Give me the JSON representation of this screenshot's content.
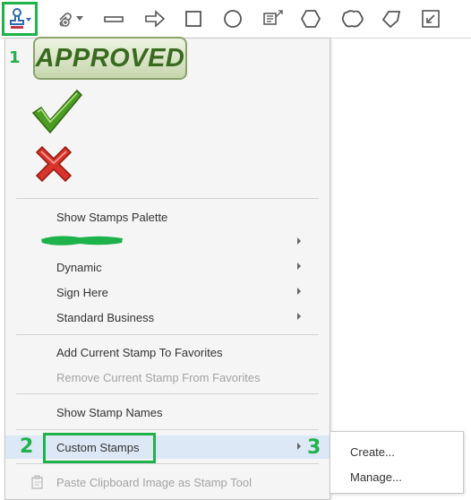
{
  "toolbar": {
    "tools": [
      "stamp-icon",
      "attach-icon",
      "line-icon",
      "arrow-icon",
      "rectangle-icon",
      "oval-icon",
      "textbox-icon",
      "polygon-icon",
      "cloud-icon",
      "polyline-icon",
      "expand-icon"
    ]
  },
  "stamps": {
    "approved_label": "APPROVED",
    "check": "check-stamp",
    "cross": "cross-stamp"
  },
  "menu": {
    "show_palette": "Show Stamps Palette",
    "dynamic": "Dynamic",
    "sign_here": "Sign Here",
    "standard_business": "Standard Business",
    "add_favorite": "Add Current Stamp To Favorites",
    "remove_favorite": "Remove Current Stamp From Favorites",
    "show_names": "Show Stamp Names",
    "custom_stamps": "Custom Stamps",
    "paste_clipboard": "Paste Clipboard Image as Stamp Tool"
  },
  "submenu": {
    "create": "Create...",
    "manage": "Manage..."
  },
  "annotations": {
    "one": "1",
    "two": "2",
    "three": "3"
  },
  "colors": {
    "annotation_green": "#1db34a",
    "highlight": "#dce8f5",
    "approved_text": "#386a1f",
    "check_green": "#3f8a1d",
    "cross_red": "#d2302a"
  }
}
